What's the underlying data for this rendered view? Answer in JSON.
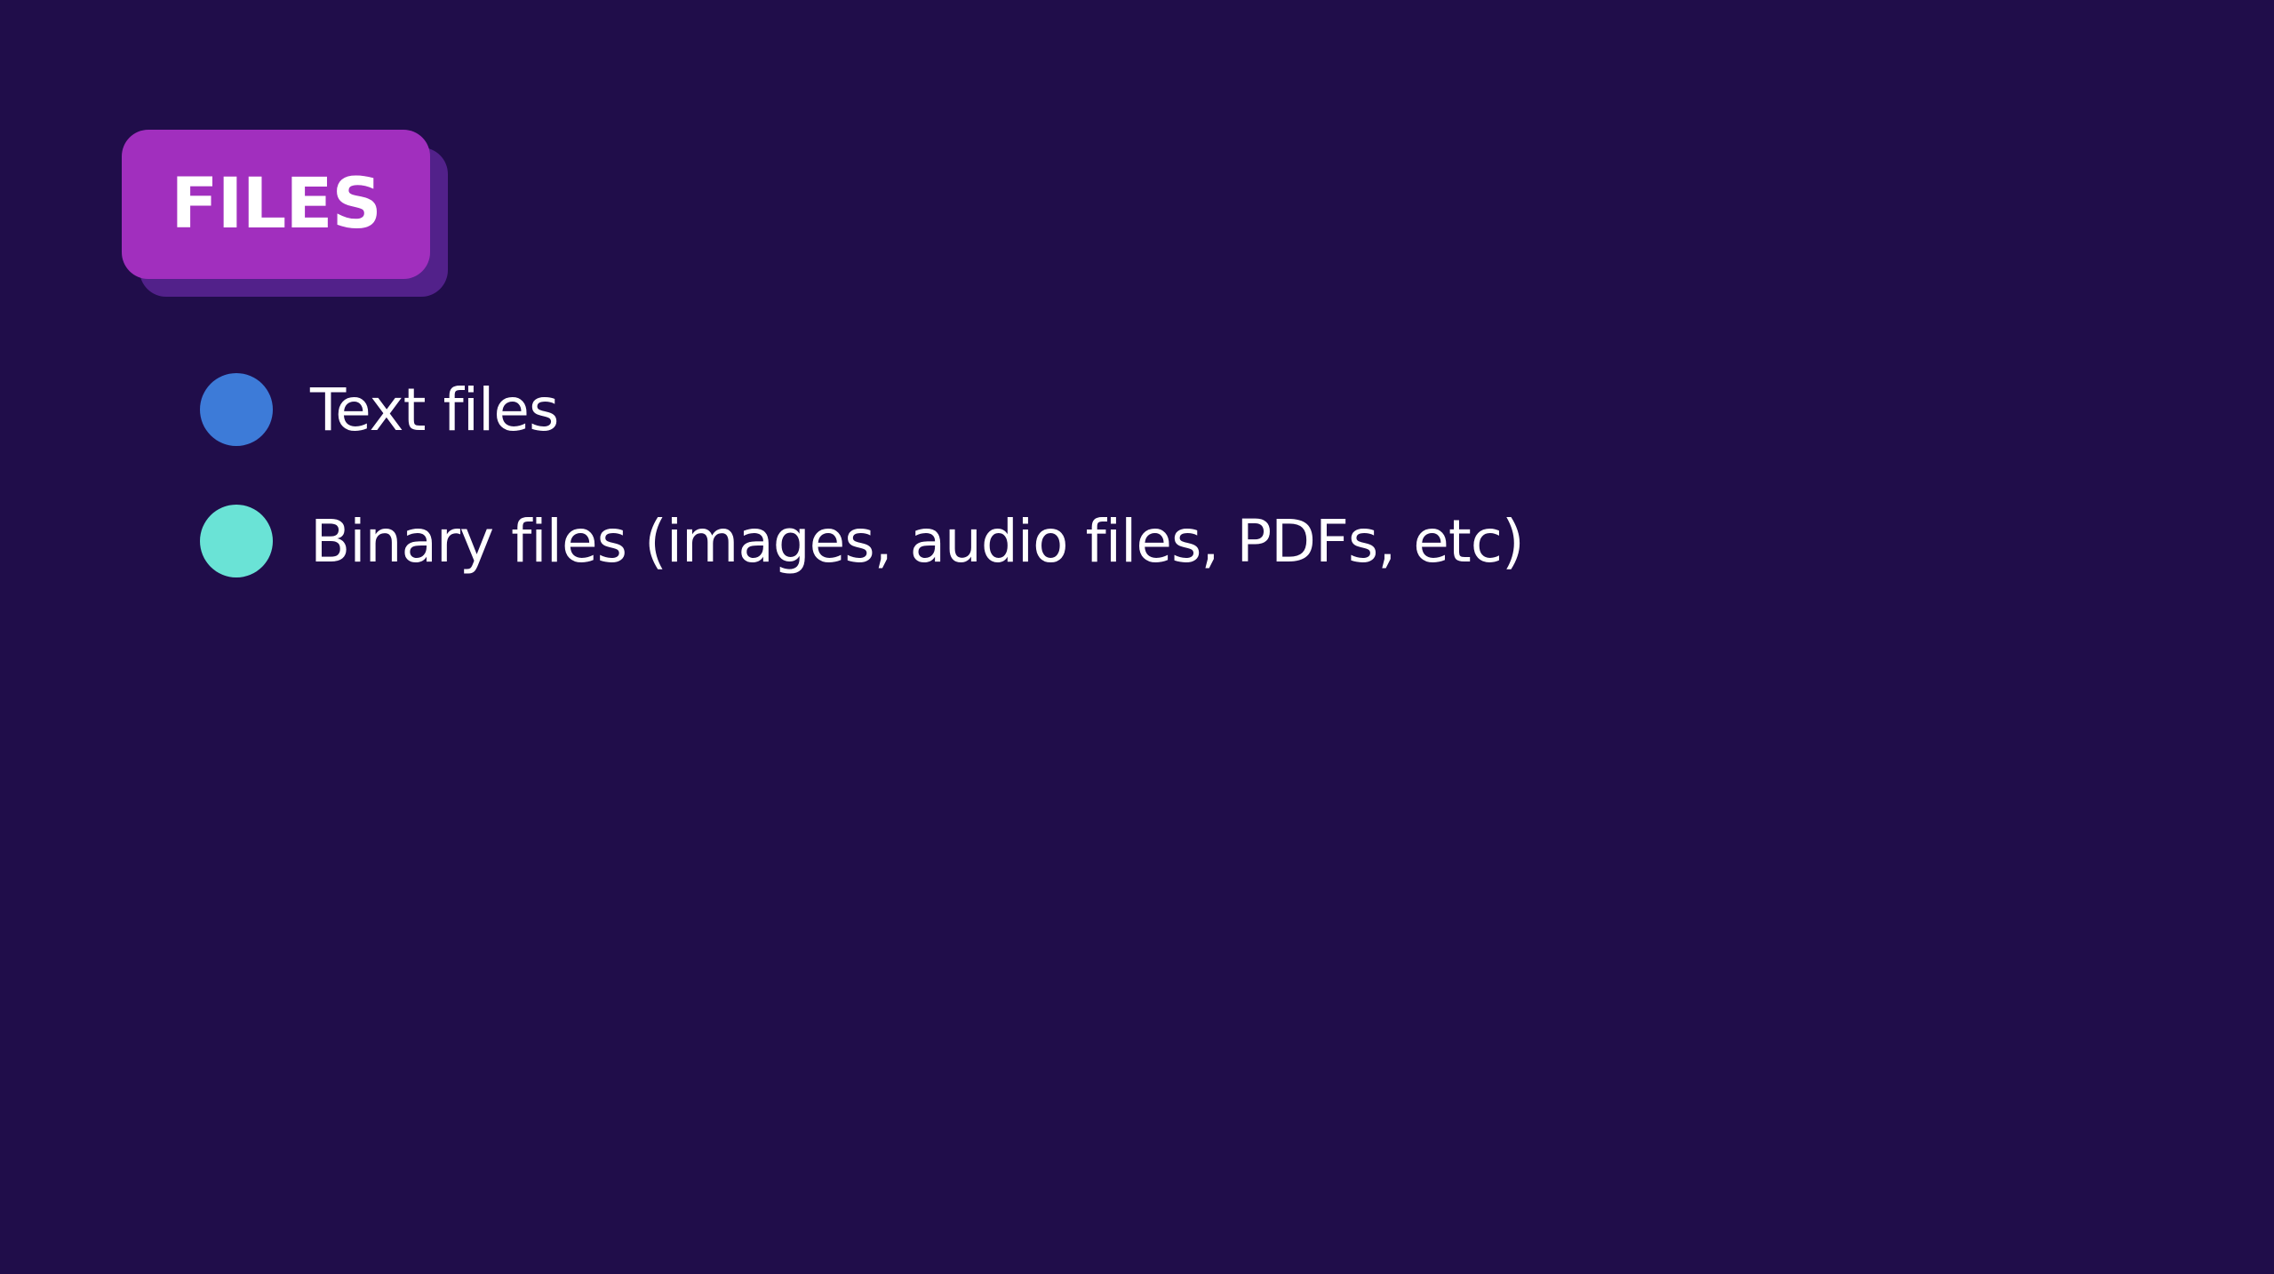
{
  "slide": {
    "title": "FILES",
    "bullets": [
      {
        "text": "Text files",
        "color": "#3d7bd8"
      },
      {
        "text": "Binary files (images, audio files, PDFs, etc)",
        "color": "#6ae3d6"
      }
    ]
  },
  "colors": {
    "background": "#200d4a",
    "badge": "#a12fbe",
    "badge_shadow": "#52218a",
    "text": "#ffffff"
  }
}
